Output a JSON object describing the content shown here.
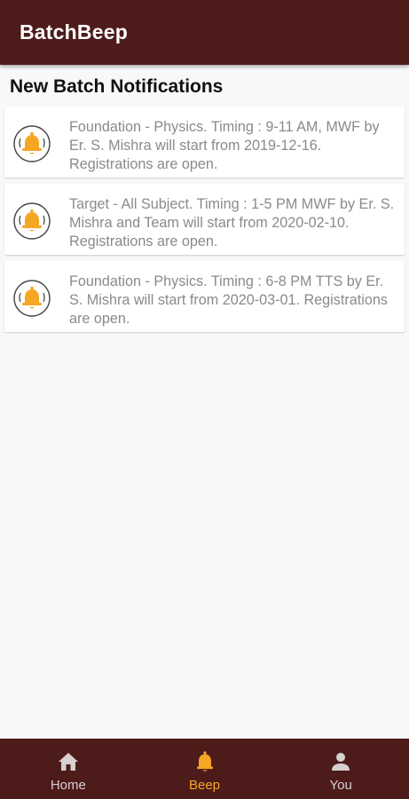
{
  "app": {
    "title": "BatchBeep",
    "bar_color": "#4e1b1b",
    "accent_color": "#f5a623"
  },
  "section": {
    "title": "New Batch Notifications"
  },
  "notifications": [
    {
      "icon": "bell-icon",
      "text": "Foundation - Physics. Timing : 9-11 AM, MWF by Er. S. Mishra will start from 2019-12-16. Registrations are open."
    },
    {
      "icon": "bell-icon",
      "text": "Target - All Subject. Timing : 1-5 PM MWF by Er. S. Mishra and Team will start from 2020-02-10. Registrations are open."
    },
    {
      "icon": "bell-icon",
      "text": "Foundation - Physics. Timing : 6-8 PM TTS by Er. S. Mishra will start from 2020-03-01. Registrations are open."
    }
  ],
  "bottom_nav": {
    "items": [
      {
        "label": "Home",
        "icon": "home-icon",
        "active": false
      },
      {
        "label": "Beep",
        "icon": "bell-icon",
        "active": true
      },
      {
        "label": "You",
        "icon": "person-icon",
        "active": false
      }
    ]
  }
}
